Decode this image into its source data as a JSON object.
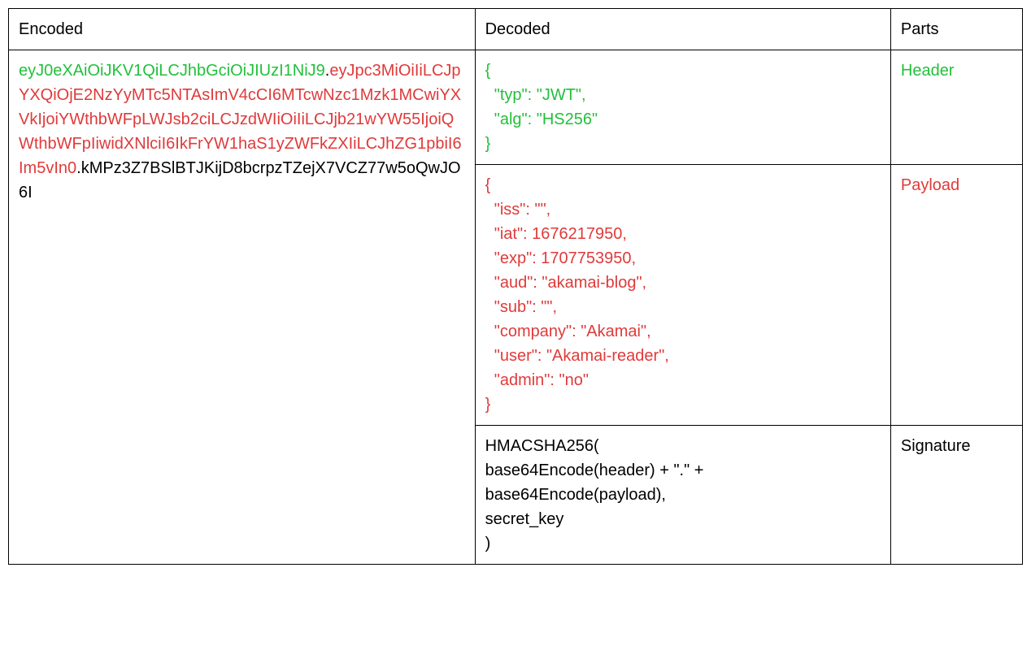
{
  "headers": {
    "encoded": "Encoded",
    "decoded": "Decoded",
    "parts": "Parts"
  },
  "parts": {
    "header": "Header",
    "payload": "Payload",
    "signature": "Signature"
  },
  "encoded": {
    "header": "eyJ0eXAiOiJKV1QiLCJhbGciOiJIUzI1NiJ9",
    "sep1": ".",
    "payload": "eyJpc3MiOiIiLCJpYXQiOjE2NzYyMTc5NTAsImV4cCI6MTcwNzc1Mzk1MCwiYXVkIjoiYWthbWFpLWJsb2ciLCJzdWIiOiIiLCJjb21wYW55IjoiQWthbWFpIiwidXNlciI6IkFrYW1haS1yZWFkZXIiLCJhZG1pbiI6Im5vIn0",
    "sep2": ".",
    "signature": "kMPz3Z7BSlBTJKijD8bcrpzTZejX7VCZ77w5oQwJO6I"
  },
  "decoded": {
    "header": "{\n  \"typ\": \"JWT\",\n  \"alg\": \"HS256\"\n}",
    "payload": "{\n  \"iss\": \"\",\n  \"iat\": 1676217950,\n  \"exp\": 1707753950,\n  \"aud\": \"akamai-blog\",\n  \"sub\": \"\",\n  \"company\": \"Akamai\",\n  \"user\": \"Akamai-reader\",\n  \"admin\": \"no\"\n}",
    "signature": "HMACSHA256(\nbase64Encode(header) + \".\" +\nbase64Encode(payload),\nsecret_key\n)"
  }
}
